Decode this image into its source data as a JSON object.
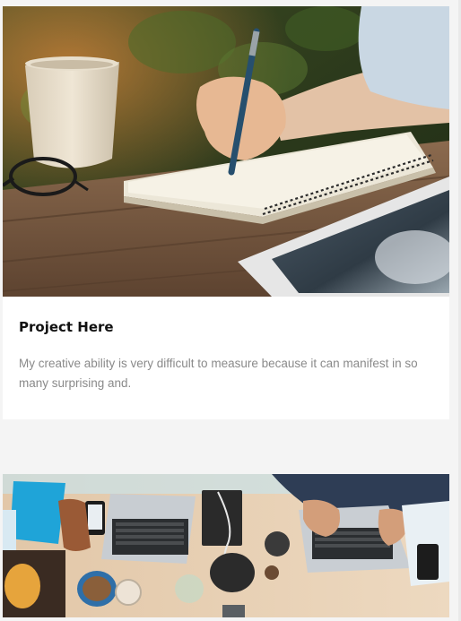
{
  "projects": [
    {
      "title": "Project Here",
      "description": "My creative ability is very difficult to measure because it can manifest in so many surprising and.",
      "image": "notebook-writing-photo"
    },
    {
      "image": "desk-laptops-photo"
    }
  ],
  "colors": {
    "page_background": "#f4f4f4",
    "card_background": "#ffffff",
    "title": "#111111",
    "description": "#8a8a8a"
  }
}
